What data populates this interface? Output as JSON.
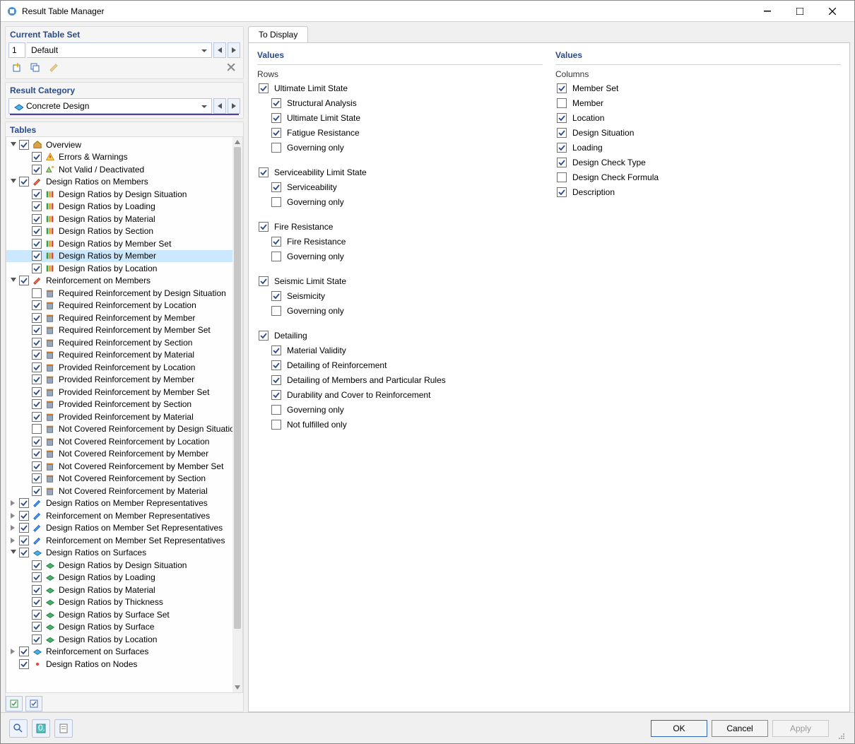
{
  "window": {
    "title": "Result Table Manager"
  },
  "current_table_set": {
    "header": "Current Table Set",
    "number": "1",
    "name": "Default"
  },
  "result_category": {
    "header": "Result Category",
    "value": "Concrete Design"
  },
  "tables": {
    "header": "Tables",
    "tree": [
      {
        "label": "Overview",
        "checked": true,
        "expanded": true,
        "depth": 0,
        "icon": "home",
        "children": [
          {
            "label": "Errors & Warnings",
            "checked": true,
            "depth": 1,
            "icon": "warn"
          },
          {
            "label": "Not Valid / Deactivated",
            "checked": true,
            "depth": 1,
            "icon": "deact"
          }
        ]
      },
      {
        "label": "Design Ratios on Members",
        "checked": true,
        "expanded": true,
        "depth": 0,
        "icon": "pencil1",
        "children": [
          {
            "label": "Design Ratios by Design Situation",
            "checked": true,
            "depth": 1,
            "icon": "drm"
          },
          {
            "label": "Design Ratios by Loading",
            "checked": true,
            "depth": 1,
            "icon": "drm"
          },
          {
            "label": "Design Ratios by Material",
            "checked": true,
            "depth": 1,
            "icon": "drm"
          },
          {
            "label": "Design Ratios by Section",
            "checked": true,
            "depth": 1,
            "icon": "drm"
          },
          {
            "label": "Design Ratios by Member Set",
            "checked": true,
            "depth": 1,
            "icon": "drm"
          },
          {
            "label": "Design Ratios by Member",
            "checked": true,
            "depth": 1,
            "icon": "drm",
            "selected": true
          },
          {
            "label": "Design Ratios by Location",
            "checked": true,
            "depth": 1,
            "icon": "drm"
          }
        ]
      },
      {
        "label": "Reinforcement on Members",
        "checked": true,
        "expanded": true,
        "depth": 0,
        "icon": "pencil1",
        "children": [
          {
            "label": "Required Reinforcement by Design Situation",
            "checked": false,
            "depth": 1,
            "icon": "trash"
          },
          {
            "label": "Required Reinforcement by Location",
            "checked": true,
            "depth": 1,
            "icon": "trash"
          },
          {
            "label": "Required Reinforcement by Member",
            "checked": true,
            "depth": 1,
            "icon": "trash"
          },
          {
            "label": "Required Reinforcement by Member Set",
            "checked": true,
            "depth": 1,
            "icon": "trash"
          },
          {
            "label": "Required Reinforcement by Section",
            "checked": true,
            "depth": 1,
            "icon": "trash"
          },
          {
            "label": "Required Reinforcement by Material",
            "checked": true,
            "depth": 1,
            "icon": "trash"
          },
          {
            "label": "Provided Reinforcement by Location",
            "checked": true,
            "depth": 1,
            "icon": "trash"
          },
          {
            "label": "Provided Reinforcement by Member",
            "checked": true,
            "depth": 1,
            "icon": "trash"
          },
          {
            "label": "Provided Reinforcement by Member Set",
            "checked": true,
            "depth": 1,
            "icon": "trash"
          },
          {
            "label": "Provided Reinforcement by Section",
            "checked": true,
            "depth": 1,
            "icon": "trash"
          },
          {
            "label": "Provided Reinforcement by Material",
            "checked": true,
            "depth": 1,
            "icon": "trash"
          },
          {
            "label": "Not Covered Reinforcement by Design Situation",
            "checked": false,
            "depth": 1,
            "icon": "trash"
          },
          {
            "label": "Not Covered Reinforcement by Location",
            "checked": true,
            "depth": 1,
            "icon": "trash"
          },
          {
            "label": "Not Covered Reinforcement by Member",
            "checked": true,
            "depth": 1,
            "icon": "trash"
          },
          {
            "label": "Not Covered Reinforcement by Member Set",
            "checked": true,
            "depth": 1,
            "icon": "trash"
          },
          {
            "label": "Not Covered Reinforcement by Section",
            "checked": true,
            "depth": 1,
            "icon": "trash"
          },
          {
            "label": "Not Covered Reinforcement by Material",
            "checked": true,
            "depth": 1,
            "icon": "trash"
          }
        ]
      },
      {
        "label": "Design Ratios on Member Representatives",
        "checked": true,
        "expanded": false,
        "depth": 0,
        "icon": "pencil2",
        "children": []
      },
      {
        "label": "Reinforcement on Member Representatives",
        "checked": true,
        "expanded": false,
        "depth": 0,
        "icon": "pencil2",
        "children": []
      },
      {
        "label": "Design Ratios on Member Set Representatives",
        "checked": true,
        "expanded": false,
        "depth": 0,
        "icon": "pencil2",
        "children": []
      },
      {
        "label": "Reinforcement on Member Set Representatives",
        "checked": true,
        "expanded": false,
        "depth": 0,
        "icon": "pencil2",
        "children": []
      },
      {
        "label": "Design Ratios on Surfaces",
        "checked": true,
        "expanded": true,
        "depth": 0,
        "icon": "surf",
        "children": [
          {
            "label": "Design Ratios by Design Situation",
            "checked": true,
            "depth": 1,
            "icon": "surfc"
          },
          {
            "label": "Design Ratios by Loading",
            "checked": true,
            "depth": 1,
            "icon": "surfc"
          },
          {
            "label": "Design Ratios by Material",
            "checked": true,
            "depth": 1,
            "icon": "surfc"
          },
          {
            "label": "Design Ratios by Thickness",
            "checked": true,
            "depth": 1,
            "icon": "surfc"
          },
          {
            "label": "Design Ratios by Surface Set",
            "checked": true,
            "depth": 1,
            "icon": "surfc"
          },
          {
            "label": "Design Ratios by Surface",
            "checked": true,
            "depth": 1,
            "icon": "surfc"
          },
          {
            "label": "Design Ratios by Location",
            "checked": true,
            "depth": 1,
            "icon": "surfc"
          }
        ]
      },
      {
        "label": "Reinforcement on Surfaces",
        "checked": true,
        "expanded": false,
        "depth": 0,
        "icon": "surf",
        "children": []
      },
      {
        "label": "Design Ratios on Nodes",
        "checked": true,
        "expanded": false,
        "depth": 0,
        "icon": "node",
        "nochev": true,
        "children": []
      }
    ]
  },
  "to_display": {
    "tab_label": "To Display",
    "values_header": "Values",
    "rows_label": "Rows",
    "columns_label": "Columns",
    "rows": [
      {
        "label": "Ultimate Limit State",
        "checked": true,
        "items": [
          {
            "label": "Structural Analysis",
            "checked": true
          },
          {
            "label": "Ultimate Limit State",
            "checked": true
          },
          {
            "label": "Fatigue Resistance",
            "checked": true
          },
          {
            "label": "Governing only",
            "checked": false
          }
        ]
      },
      {
        "label": "Serviceability Limit State",
        "checked": true,
        "items": [
          {
            "label": "Serviceability",
            "checked": true
          },
          {
            "label": "Governing only",
            "checked": false
          }
        ]
      },
      {
        "label": "Fire Resistance",
        "checked": true,
        "items": [
          {
            "label": "Fire Resistance",
            "checked": true
          },
          {
            "label": "Governing only",
            "checked": false
          }
        ]
      },
      {
        "label": "Seismic Limit State",
        "checked": true,
        "items": [
          {
            "label": "Seismicity",
            "checked": true
          },
          {
            "label": "Governing only",
            "checked": false
          }
        ]
      },
      {
        "label": "Detailing",
        "checked": true,
        "items": [
          {
            "label": "Material Validity",
            "checked": true
          },
          {
            "label": "Detailing of Reinforcement",
            "checked": true
          },
          {
            "label": "Detailing of Members and Particular Rules",
            "checked": true
          },
          {
            "label": "Durability and Cover to Reinforcement",
            "checked": true
          },
          {
            "label": "Governing only",
            "checked": false
          },
          {
            "label": "Not fulfilled only",
            "checked": false
          }
        ]
      }
    ],
    "columns": [
      {
        "label": "Member Set",
        "checked": true
      },
      {
        "label": "Member",
        "checked": false
      },
      {
        "label": "Location",
        "checked": true
      },
      {
        "label": "Design Situation",
        "checked": true
      },
      {
        "label": "Loading",
        "checked": true
      },
      {
        "label": "Design Check Type",
        "checked": true
      },
      {
        "label": "Design Check Formula",
        "checked": false
      },
      {
        "label": "Description",
        "checked": true
      }
    ]
  },
  "buttons": {
    "ok": "OK",
    "cancel": "Cancel",
    "apply": "Apply"
  }
}
